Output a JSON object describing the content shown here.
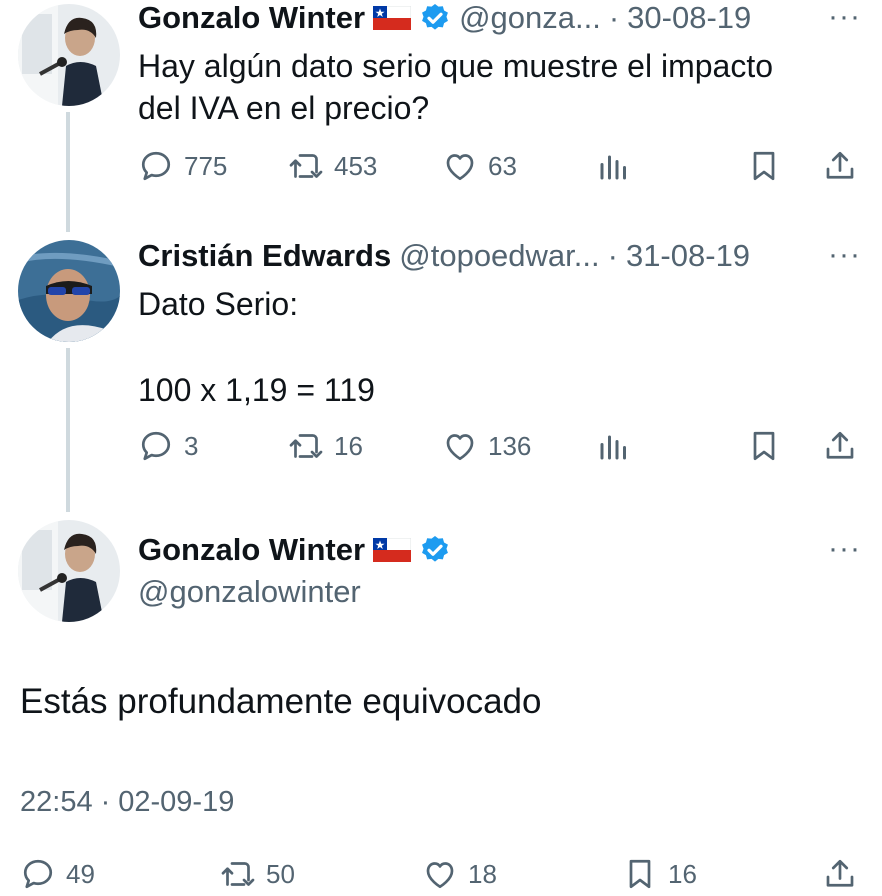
{
  "tweet1": {
    "name": "Gonzalo Winter",
    "handle": "@gonza...",
    "separator": "·",
    "date": "30-08-19",
    "text_line1": "Hay algún dato serio que muestre el impacto",
    "text_line2": "del IVA en el precio?",
    "replies": "775",
    "retweets": "453",
    "likes": "63"
  },
  "tweet2": {
    "name": "Cristián Edwards",
    "handle": "@topoedwar...",
    "separator": "·",
    "date": "31-08-19",
    "text_line1": "Dato Serio:",
    "text_line2": "100 x 1,19 = 119",
    "replies": "3",
    "retweets": "16",
    "likes": "136"
  },
  "main_tweet": {
    "name": "Gonzalo Winter",
    "handle": "@gonzalowinter",
    "text": "Estás profundamente equivocado",
    "time": "22:54",
    "separator": "·",
    "date": "02-09-19",
    "replies": "49",
    "retweets": "50",
    "likes": "18",
    "bookmarks": "16"
  },
  "more_label": "···",
  "colors": {
    "verified": "#1d9bf0",
    "muted": "#536471",
    "thread_line": "#cfd9de",
    "flag_red": "#d52b1e",
    "flag_blue": "#0039a6"
  },
  "icons": [
    "reply-icon",
    "retweet-icon",
    "like-icon",
    "views-icon",
    "bookmark-icon",
    "share-icon",
    "verified-badge-icon",
    "chile-flag-icon",
    "more-options-icon"
  ]
}
